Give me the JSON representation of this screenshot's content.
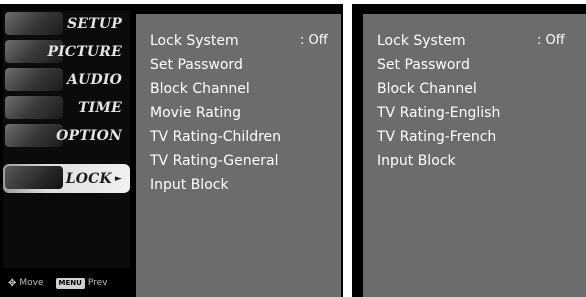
{
  "left_screen": {
    "sidebar": {
      "items": [
        {
          "label": "SETUP",
          "icon": "setup-thumbnail"
        },
        {
          "label": "PICTURE",
          "icon": "picture-thumbnail"
        },
        {
          "label": "AUDIO",
          "icon": "audio-thumbnail"
        },
        {
          "label": "TIME",
          "icon": "time-thumbnail"
        },
        {
          "label": "OPTION",
          "icon": "option-thumbnail"
        },
        {
          "label": "LOCK",
          "icon": "lock-thumbnail",
          "selected": true
        }
      ],
      "footer": {
        "move_label": "Move",
        "menu_key": "MENU",
        "prev_label": "Prev"
      }
    },
    "options": [
      {
        "label": "Lock System",
        "value": ": Off"
      },
      {
        "label": "Set Password"
      },
      {
        "label": "Block Channel"
      },
      {
        "label": "Movie Rating"
      },
      {
        "label": "TV Rating-Children"
      },
      {
        "label": "TV Rating-General"
      },
      {
        "label": "Input Block"
      }
    ]
  },
  "right_screen": {
    "options": [
      {
        "label": "Lock System",
        "value": ": Off"
      },
      {
        "label": "Set Password"
      },
      {
        "label": "Block Channel"
      },
      {
        "label": "TV Rating-English"
      },
      {
        "label": "TV Rating-French"
      },
      {
        "label": "Input Block"
      }
    ]
  },
  "colors": {
    "panel_bg": "#6c6c6c",
    "frame_bg": "#000000",
    "selected_tab": "#e6e6e6",
    "text": "#ffffff"
  }
}
